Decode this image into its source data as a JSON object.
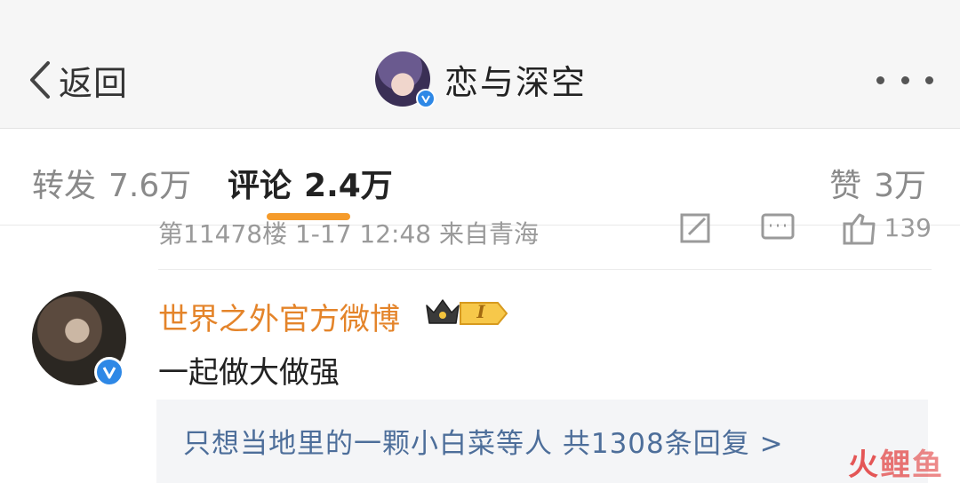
{
  "header": {
    "back_label": "返回",
    "account_name": "恋与深空",
    "verified_badge_color": "#2e88e6"
  },
  "tabs": {
    "forward": {
      "label": "转发",
      "count": "7.6万"
    },
    "comment": {
      "label": "评论",
      "count": "2.4万",
      "active": true,
      "accent": "#f59b2b"
    },
    "like": {
      "label": "赞",
      "count": "3万"
    }
  },
  "previous_comment": {
    "meta": "第11478楼  1-17  12:48  来自青海",
    "like_count": "139",
    "action_icons": [
      "share-icon",
      "comment-icon",
      "like-icon"
    ]
  },
  "comment": {
    "author": "世界之外官方微博",
    "author_color": "#e4842a",
    "member_level": "I",
    "text": "一起做大做强",
    "replies_summary": "只想当地里的一颗小白菜等人  共1308条回复 >"
  },
  "watermark": [
    "火",
    "鲤",
    "鱼"
  ]
}
